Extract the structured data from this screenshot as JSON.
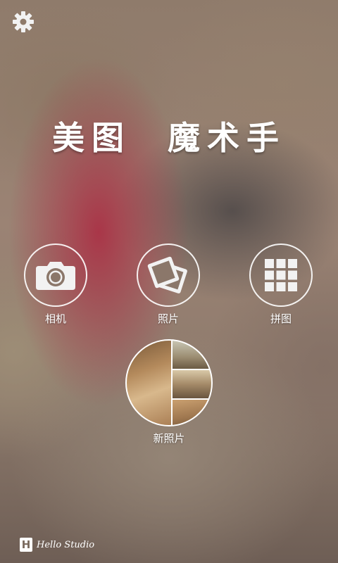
{
  "header": {
    "settings_icon": "gear-icon"
  },
  "title": {
    "text": "美图  魔术手"
  },
  "actions": [
    {
      "label": "相机",
      "icon": "camera-icon"
    },
    {
      "label": "照片",
      "icon": "photos-icon"
    },
    {
      "label": "拼图",
      "icon": "grid-icon"
    }
  ],
  "new_photos": {
    "label": "新照片",
    "icon": "photo-collage"
  },
  "footer": {
    "brand": "Hello Studio",
    "logo_letter": "H"
  },
  "colors": {
    "accent": "#ffffff",
    "background_base": "#8f7b6b"
  }
}
